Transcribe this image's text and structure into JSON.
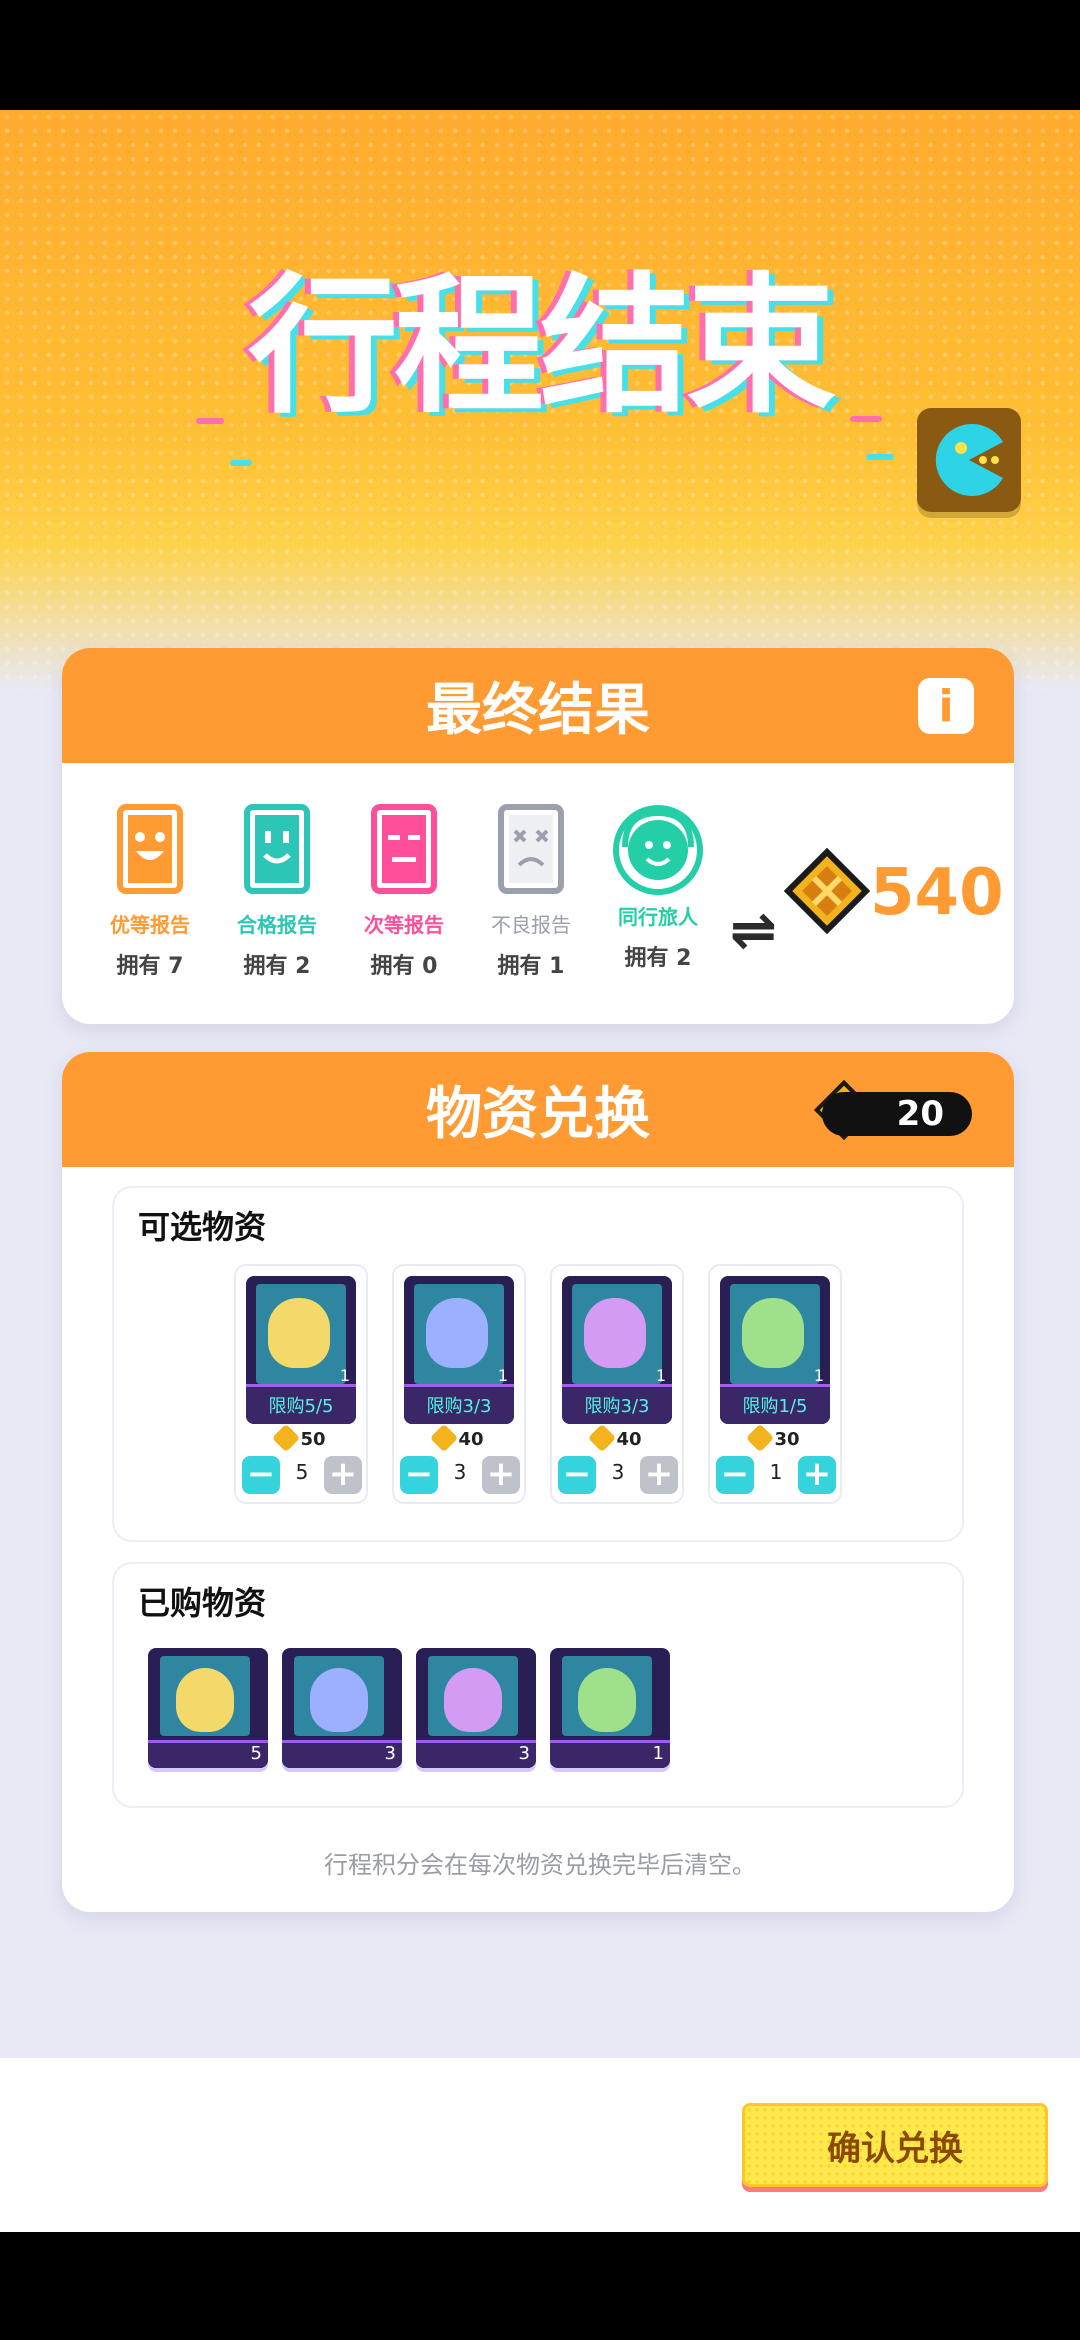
{
  "hero": {
    "title": "行程结束"
  },
  "result": {
    "title": "最终结果",
    "info_label": "i",
    "reports": [
      {
        "label": "优等报告",
        "own": "拥有 7",
        "color": "#ff9b32"
      },
      {
        "label": "合格报告",
        "own": "拥有 2",
        "color": "#2cc6b7"
      },
      {
        "label": "次等报告",
        "own": "拥有 0",
        "color": "#ff4f9b"
      },
      {
        "label": "不良报告",
        "own": "拥有 1",
        "color": "#9aa0ad"
      },
      {
        "label": "同行旅人",
        "own": "拥有 2",
        "color": "#24cfa7"
      }
    ],
    "swap_icon": "⇌",
    "total": "540"
  },
  "exchange": {
    "title": "物资兑换",
    "balance": "20",
    "optional_title": "可选物资",
    "items": [
      {
        "limit": "限购5/5",
        "price": "50",
        "count": "1",
        "qty": "5",
        "plus_active": false,
        "face_color": "#f3d96a"
      },
      {
        "limit": "限购3/3",
        "price": "40",
        "count": "1",
        "qty": "3",
        "plus_active": false,
        "face_color": "#9db0ff"
      },
      {
        "limit": "限购3/3",
        "price": "40",
        "count": "1",
        "qty": "3",
        "plus_active": false,
        "face_color": "#d49bf5"
      },
      {
        "limit": "限购1/5",
        "price": "30",
        "count": "1",
        "qty": "1",
        "plus_active": true,
        "face_color": "#9fe08a"
      }
    ],
    "bought_title": "已购物资",
    "bought": [
      {
        "count": "5",
        "face_color": "#f3d96a"
      },
      {
        "count": "3",
        "face_color": "#9db0ff"
      },
      {
        "count": "3",
        "face_color": "#d49bf5"
      },
      {
        "count": "1",
        "face_color": "#9fe08a"
      }
    ],
    "note": "行程积分会在每次物资兑换完毕后清空。"
  },
  "footer": {
    "confirm_label": "确认兑换"
  },
  "colors": {
    "accent": "#ff9b32",
    "teal": "#35d4dc",
    "confirm": "#ffe94a"
  }
}
